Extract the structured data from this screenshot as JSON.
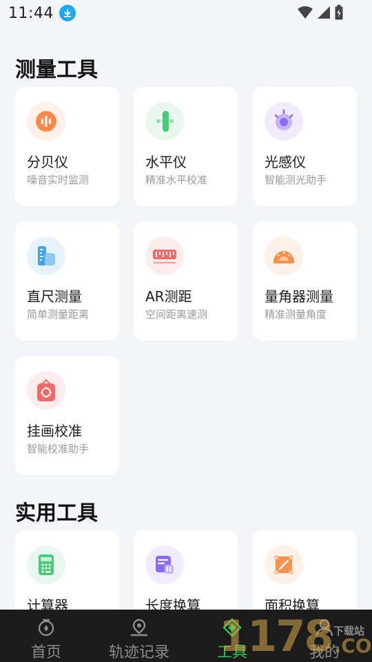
{
  "status": {
    "time": "11:44"
  },
  "sections": [
    {
      "title": "测量工具",
      "cards": [
        {
          "title": "分贝仪",
          "subtitle": "噪音实时监测",
          "icon": "decibel-icon",
          "color": "#ff8a4c",
          "bg": "#fff1e8"
        },
        {
          "title": "水平仪",
          "subtitle": "精准水平校准",
          "icon": "level-icon",
          "color": "#49c97a",
          "bg": "#e9f8ee"
        },
        {
          "title": "光感仪",
          "subtitle": "智能测光助手",
          "icon": "light-sensor-icon",
          "color": "#8c6cf2",
          "bg": "#f0ebfd"
        },
        {
          "title": "直尺测量",
          "subtitle": "简单测量距离",
          "icon": "ruler-icon",
          "color": "#3fa3f0",
          "bg": "#e6f3fd"
        },
        {
          "title": "AR测距",
          "subtitle": "空间距离速测",
          "icon": "ar-distance-icon",
          "color": "#f06a6a",
          "bg": "#fdecec"
        },
        {
          "title": "量角器测量",
          "subtitle": "精准测量角度",
          "icon": "protractor-icon",
          "color": "#f5934e",
          "bg": "#fef1e7"
        },
        {
          "title": "挂画校准",
          "subtitle": "智能校准助手",
          "icon": "picture-align-icon",
          "color": "#f06a6a",
          "bg": "#fdecec"
        }
      ]
    },
    {
      "title": "实用工具",
      "cards": [
        {
          "title": "计算器",
          "icon": "calculator-icon",
          "color": "#49c97a",
          "bg": "#e9f8ee"
        },
        {
          "title": "长度换算",
          "icon": "length-convert-icon",
          "color": "#8c6cf2",
          "bg": "#f0ebfd"
        },
        {
          "title": "面积换算",
          "icon": "area-convert-icon",
          "color": "#f5934e",
          "bg": "#fef1e7"
        }
      ]
    }
  ],
  "nav": [
    {
      "label": "首页",
      "icon": "home-icon",
      "active": false
    },
    {
      "label": "轨迹记录",
      "icon": "location-pin-icon",
      "active": false
    },
    {
      "label": "工具",
      "icon": "tools-icon",
      "active": true
    },
    {
      "label": "我的",
      "icon": "profile-icon",
      "active": false
    }
  ],
  "watermark": {
    "digits": "1178",
    "com": ".COM",
    "site": "下载站"
  },
  "colors": {
    "accent": "#27c65a",
    "background": "#f4f5f9",
    "nav_bg": "#1b1b1b"
  }
}
